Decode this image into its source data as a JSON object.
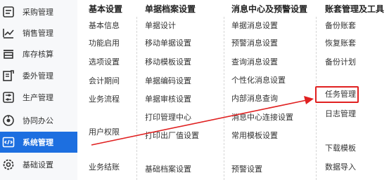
{
  "sidebar": {
    "items": [
      {
        "label": "采购管理",
        "icon": "purchase-icon"
      },
      {
        "label": "销售管理",
        "icon": "sales-chart-icon"
      },
      {
        "label": "库存核算",
        "icon": "inventory-icon"
      },
      {
        "label": "委外管理",
        "icon": "outsource-icon"
      },
      {
        "label": "生产管理",
        "icon": "production-icon"
      },
      {
        "label": "协同办公",
        "icon": "collaboration-icon"
      },
      {
        "label": "系统管理",
        "icon": "system-code-icon",
        "active": true
      },
      {
        "label": "基础设置",
        "icon": "settings-icon"
      }
    ],
    "active_color": "#1d6fe0"
  },
  "columns": [
    {
      "title": "基本设置",
      "items": [
        "基本信息",
        "功能启用",
        "选项设置",
        "会计期间",
        "业务流程",
        "用户权限",
        "业务结账"
      ]
    },
    {
      "title": "单据档案设置",
      "items": [
        "单据设计",
        "移动单据设置",
        "移动模板设置",
        "单据编码设置",
        "单据审核设置",
        "打印管理中心",
        "打印出厂值设置",
        "基础档案设置"
      ]
    },
    {
      "title": "消息中心及预警设置",
      "items": [
        "单据消息设置",
        "预警消息设置",
        "查询消息设置",
        "个性化消息设置",
        "内部消息查询",
        "消息中心连接设置",
        "常用模板设置",
        "预警设置"
      ]
    },
    {
      "title": "账套管理及工具",
      "items": [
        "备份账套",
        "恢复账套",
        "备份计划",
        "任务管理",
        "日志管理",
        "下载模板",
        "数据导入"
      ]
    }
  ],
  "annotation": {
    "highlight_color": "#e02020"
  }
}
